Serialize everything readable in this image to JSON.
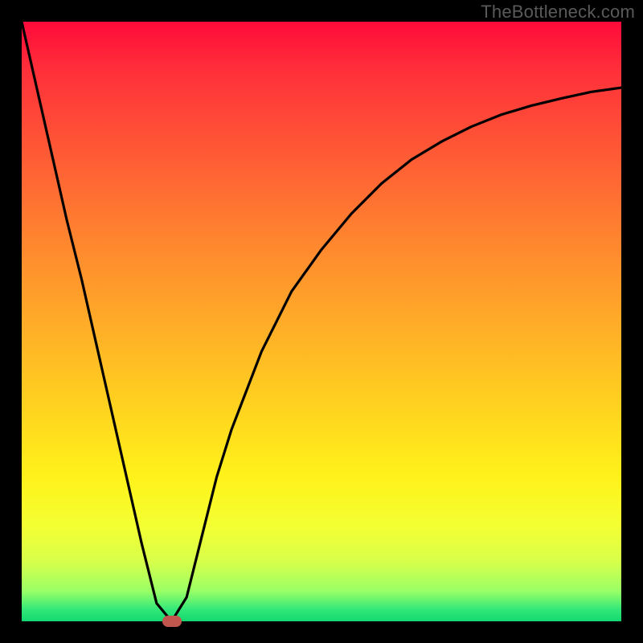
{
  "watermark": "TheBottleneck.com",
  "chart_data": {
    "type": "line",
    "title": "",
    "xlabel": "",
    "ylabel": "",
    "x": [
      0,
      2.5,
      5,
      7.5,
      10,
      12.5,
      15,
      17.5,
      20,
      22.5,
      25,
      27.5,
      30,
      32.5,
      35,
      40,
      45,
      50,
      55,
      60,
      65,
      70,
      75,
      80,
      85,
      90,
      95,
      100
    ],
    "y": [
      100,
      89,
      78,
      67,
      57,
      46,
      35,
      24,
      13,
      3,
      0,
      4,
      14,
      24,
      32,
      45,
      55,
      62,
      68,
      73,
      77,
      80,
      82.5,
      84.5,
      86,
      87.2,
      88.3,
      89
    ],
    "xlim": [
      0,
      100
    ],
    "ylim": [
      0,
      100
    ],
    "marker": {
      "x": 25,
      "y": 0
    }
  }
}
